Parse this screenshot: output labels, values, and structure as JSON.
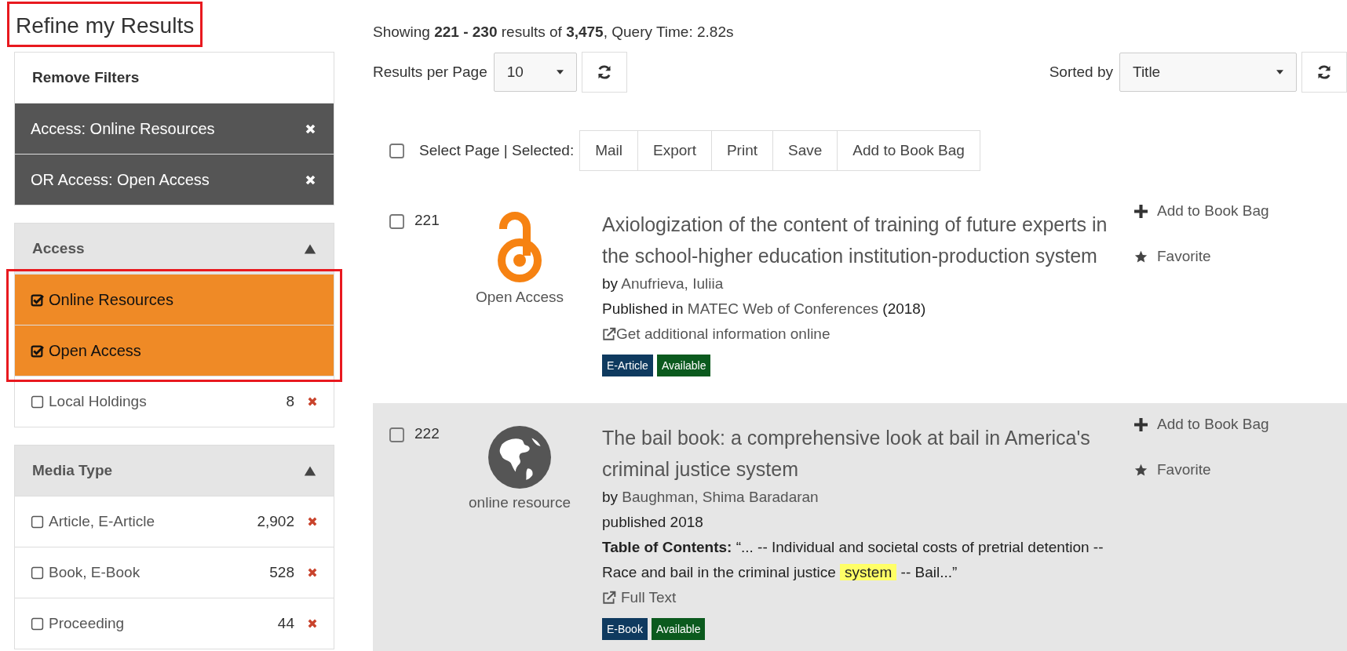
{
  "sidebar": {
    "title": "Refine my Results",
    "title_highlighted": true,
    "remove_filters": {
      "heading": "Remove Filters",
      "filters": [
        {
          "label": "Access: Online Resources"
        },
        {
          "label": "OR Access: Open Access"
        }
      ]
    },
    "facets": [
      {
        "heading": "Access",
        "expanded": true,
        "highlighted": true,
        "items": [
          {
            "label": "Online Resources",
            "checked": true
          },
          {
            "label": "Open Access",
            "checked": true
          },
          {
            "label": "Local Holdings",
            "checked": false,
            "count": "8"
          }
        ]
      },
      {
        "heading": "Media Type",
        "expanded": true,
        "highlighted": false,
        "items": [
          {
            "label": "Article, E-Article",
            "checked": false,
            "count": "2,902"
          },
          {
            "label": "Book, E-Book",
            "checked": false,
            "count": "528"
          },
          {
            "label": "Proceeding",
            "checked": false,
            "count": "44"
          }
        ]
      }
    ]
  },
  "summary": "Showing **221 - 230** results of **3,475**, Query Time: 2.82s",
  "results_per_page": {
    "label": "Results per Page",
    "value": "10"
  },
  "sort": {
    "label": "Sorted by",
    "value": "Title"
  },
  "bulk": {
    "label": "Select Page | Selected:",
    "checked": false,
    "buttons": [
      "Mail",
      "Export",
      "Print",
      "Save",
      "Add to Book Bag"
    ]
  },
  "results": [
    {
      "number": "221",
      "checked": false,
      "shaded": false,
      "format": {
        "kind": "open-access",
        "label": "Open Access"
      },
      "title": "Axiologization of the content of training of future experts in the school-higher education institution-production system",
      "author": {
        "prefix": "by",
        "name": "Anufrieva, Iuliia"
      },
      "published": {
        "prefix": "Published in",
        "link": "MATEC Web of Conferences",
        "suffix": "(2018)"
      },
      "link": "Get additional information online",
      "badges": [
        {
          "label": "E-Article",
          "color": "#0f3a5f"
        },
        {
          "label": "Available",
          "color": "#0b5a1e"
        }
      ],
      "actions": [
        {
          "kind": "add",
          "label": "Add to Book Bag"
        },
        {
          "kind": "favorite",
          "label": "Favorite"
        }
      ]
    },
    {
      "number": "222",
      "checked": false,
      "shaded": true,
      "format": {
        "kind": "online",
        "label": "online resource"
      },
      "title": "The bail book: a comprehensive look at bail in America's criminal justice system",
      "author": {
        "prefix": "by",
        "name": "Baughman, Shima Baradaran"
      },
      "published": {
        "prefix": "published 2018"
      },
      "toc": {
        "label": "Table of Contents:",
        "parts": [
          {
            "text": "“... -- Individual and societal costs of pretrial detention -- Race and bail in the criminal justice ",
            "highlighted": false
          },
          {
            "text": "system",
            "highlighted": true
          },
          {
            "text": " -- Bail...”",
            "highlighted": false
          }
        ]
      },
      "link": "Full Text",
      "badges": [
        {
          "label": "E-Book",
          "color": "#0f3a5f"
        },
        {
          "label": "Available",
          "color": "#0b5a1e"
        }
      ],
      "actions": [
        {
          "kind": "add",
          "label": "Add to Book Bag"
        },
        {
          "kind": "favorite",
          "label": "Favorite"
        }
      ]
    }
  ]
}
